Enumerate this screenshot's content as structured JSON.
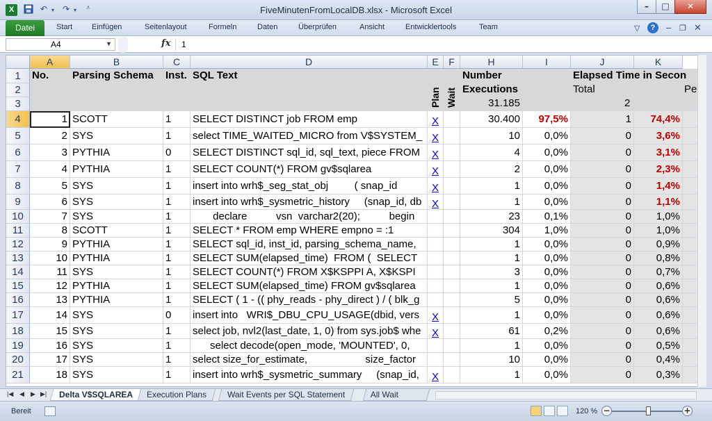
{
  "window": {
    "title": "FiveMinutenFromLocalDB.xlsx - Microsoft Excel",
    "app_icon": "X",
    "minimize": "–",
    "maximize": "□",
    "close": "✕"
  },
  "ribbon": {
    "file_tab": "Datei",
    "tabs": [
      "Start",
      "Einfügen",
      "Seitenlayout",
      "Formeln",
      "Daten",
      "Überprüfen",
      "Ansicht",
      "Entwicklertools",
      "Team"
    ]
  },
  "formula_bar": {
    "name_box": "A4",
    "fx": "fx",
    "value": "1"
  },
  "columns": [
    "A",
    "B",
    "C",
    "D",
    "E",
    "F",
    "H",
    "I",
    "J",
    "K"
  ],
  "header": {
    "no": "No.",
    "parsing_schema": "Parsing Schema",
    "inst": "Inst.",
    "sql_text": "SQL Text",
    "plan": "Plan",
    "wait": "Wait",
    "number": "Number",
    "executions": "Executions",
    "exec_total": "31.185",
    "elapsed": "Elapsed Time in Secon",
    "elapsed_total_label": "Total",
    "elapsed_total": "2",
    "per": "Pe"
  },
  "header_rows": [
    "1",
    "2",
    "3"
  ],
  "rows": [
    {
      "r": "4",
      "no": "1",
      "schema": "SCOTT",
      "inst": "1",
      "sql": "SELECT DISTINCT job FROM emp",
      "plan": "X",
      "exec": "30.400",
      "pct": "97,5%",
      "el": "1",
      "elpct": "74,4%"
    },
    {
      "r": "5",
      "no": "2",
      "schema": "SYS",
      "inst": "1",
      "sql": "select TIME_WAITED_MICRO from V$SYSTEM_",
      "plan": "X",
      "exec": "10",
      "pct": "0,0%",
      "el": "0",
      "elpct": "3,6%"
    },
    {
      "r": "6",
      "no": "3",
      "schema": "PYTHIA",
      "inst": "0",
      "sql": "SELECT DISTINCT sql_id, sql_text, piece FROM",
      "plan": "X",
      "exec": "4",
      "pct": "0,0%",
      "el": "0",
      "elpct": "3,1%"
    },
    {
      "r": "7",
      "no": "4",
      "schema": "PYTHIA",
      "inst": "1",
      "sql": "SELECT COUNT(*) FROM gv$sqlarea",
      "plan": "X",
      "exec": "2",
      "pct": "0,0%",
      "el": "0",
      "elpct": "2,3%"
    },
    {
      "r": "8",
      "no": "5",
      "schema": "SYS",
      "inst": "1",
      "sql": "insert into wrh$_seg_stat_obj         ( snap_id",
      "plan": "X",
      "exec": "1",
      "pct": "0,0%",
      "el": "0",
      "elpct": "1,4%"
    },
    {
      "r": "9",
      "no": "6",
      "schema": "SYS",
      "inst": "1",
      "sql": "insert into wrh$_sysmetric_history     (snap_id, db",
      "plan": "X",
      "exec": "1",
      "pct": "0,0%",
      "el": "0",
      "elpct": "1,1%"
    },
    {
      "r": "10",
      "no": "7",
      "schema": "SYS",
      "inst": "1",
      "sql": "       declare          vsn  varchar2(20);          begin",
      "plan": "",
      "exec": "23",
      "pct": "0,1%",
      "el": "0",
      "elpct": "1,0%"
    },
    {
      "r": "11",
      "no": "8",
      "schema": "SCOTT",
      "inst": "1",
      "sql": "SELECT * FROM emp WHERE empno = :1",
      "plan": "",
      "exec": "304",
      "pct": "1,0%",
      "el": "0",
      "elpct": "1,0%"
    },
    {
      "r": "12",
      "no": "9",
      "schema": "PYTHIA",
      "inst": "1",
      "sql": "SELECT sql_id, inst_id, parsing_schema_name,",
      "plan": "",
      "exec": "1",
      "pct": "0,0%",
      "el": "0",
      "elpct": "0,9%"
    },
    {
      "r": "13",
      "no": "10",
      "schema": "PYTHIA",
      "inst": "1",
      "sql": "SELECT SUM(elapsed_time)  FROM (  SELECT",
      "plan": "",
      "exec": "1",
      "pct": "0,0%",
      "el": "0",
      "elpct": "0,8%"
    },
    {
      "r": "14",
      "no": "11",
      "schema": "SYS",
      "inst": "1",
      "sql": "SELECT COUNT(*) FROM X$KSPPI A, X$KSPI",
      "plan": "",
      "exec": "3",
      "pct": "0,0%",
      "el": "0",
      "elpct": "0,7%"
    },
    {
      "r": "15",
      "no": "12",
      "schema": "PYTHIA",
      "inst": "1",
      "sql": "SELECT SUM(elapsed_time) FROM gv$sqlarea",
      "plan": "",
      "exec": "1",
      "pct": "0,0%",
      "el": "0",
      "elpct": "0,6%"
    },
    {
      "r": "16",
      "no": "13",
      "schema": "PYTHIA",
      "inst": "1",
      "sql": "SELECT ( 1 - (( phy_reads - phy_direct ) / ( blk_g",
      "plan": "",
      "exec": "5",
      "pct": "0,0%",
      "el": "0",
      "elpct": "0,6%"
    },
    {
      "r": "17",
      "no": "14",
      "schema": "SYS",
      "inst": "0",
      "sql": "insert into   WRI$_DBU_CPU_USAGE(dbid, vers",
      "plan": "X",
      "exec": "1",
      "pct": "0,0%",
      "el": "0",
      "elpct": "0,6%"
    },
    {
      "r": "18",
      "no": "15",
      "schema": "SYS",
      "inst": "1",
      "sql": "select job, nvl2(last_date, 1, 0) from sys.job$ whe",
      "plan": "X",
      "exec": "61",
      "pct": "0,2%",
      "el": "0",
      "elpct": "0,6%"
    },
    {
      "r": "19",
      "no": "16",
      "schema": "SYS",
      "inst": "1",
      "sql": "      select decode(open_mode, 'MOUNTED', 0,",
      "plan": "",
      "exec": "1",
      "pct": "0,0%",
      "el": "0",
      "elpct": "0,5%"
    },
    {
      "r": "20",
      "no": "17",
      "schema": "SYS",
      "inst": "1",
      "sql": "select size_for_estimate,                    size_factor",
      "plan": "",
      "exec": "10",
      "pct": "0,0%",
      "el": "0",
      "elpct": "0,4%"
    },
    {
      "r": "21",
      "no": "18",
      "schema": "SYS",
      "inst": "1",
      "sql": "insert into wrh$_sysmetric_summary     (snap_id,",
      "plan": "X",
      "exec": "1",
      "pct": "0,0%",
      "el": "0",
      "elpct": "0,3%"
    }
  ],
  "sheet_tabs": [
    "Delta V$SQLAREA",
    "Execution Plans",
    "Wait Events per SQL Statement",
    "All Wait Even"
  ],
  "status": {
    "ready": "Bereit",
    "zoom": "120 %"
  },
  "colors": {
    "accent_green": "#1f7a26",
    "red_value": "#c00000",
    "header_gray": "#d8d8d8",
    "selection_orange": "#f2c14f"
  }
}
